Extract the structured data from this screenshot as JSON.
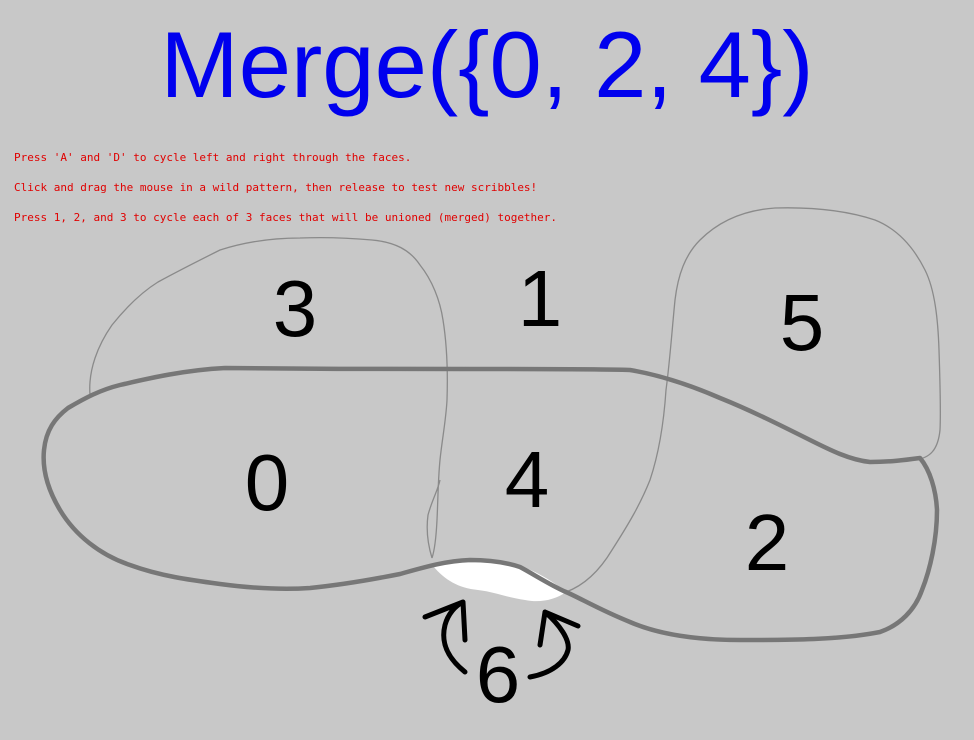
{
  "title": "Merge({0, 2, 4})",
  "instructions": [
    "Press 'A' and 'D' to cycle left and right through the faces.",
    "Click and drag the mouse in a wild pattern, then release to test new scribbles!",
    "Press 1, 2, and 3 to cycle each of 3 faces that will be unioned (merged) together."
  ],
  "faces": {
    "f0": "0",
    "f1": "1",
    "f2": "2",
    "f3": "3",
    "f4": "4",
    "f5": "5",
    "f6": "6"
  },
  "colors": {
    "background": "#c8c8c8",
    "title": "#0000ee",
    "instructions": "#e00000",
    "merged_outline": "#777777",
    "thin_outline": "#888888",
    "highlight_face": "#ffffff"
  }
}
